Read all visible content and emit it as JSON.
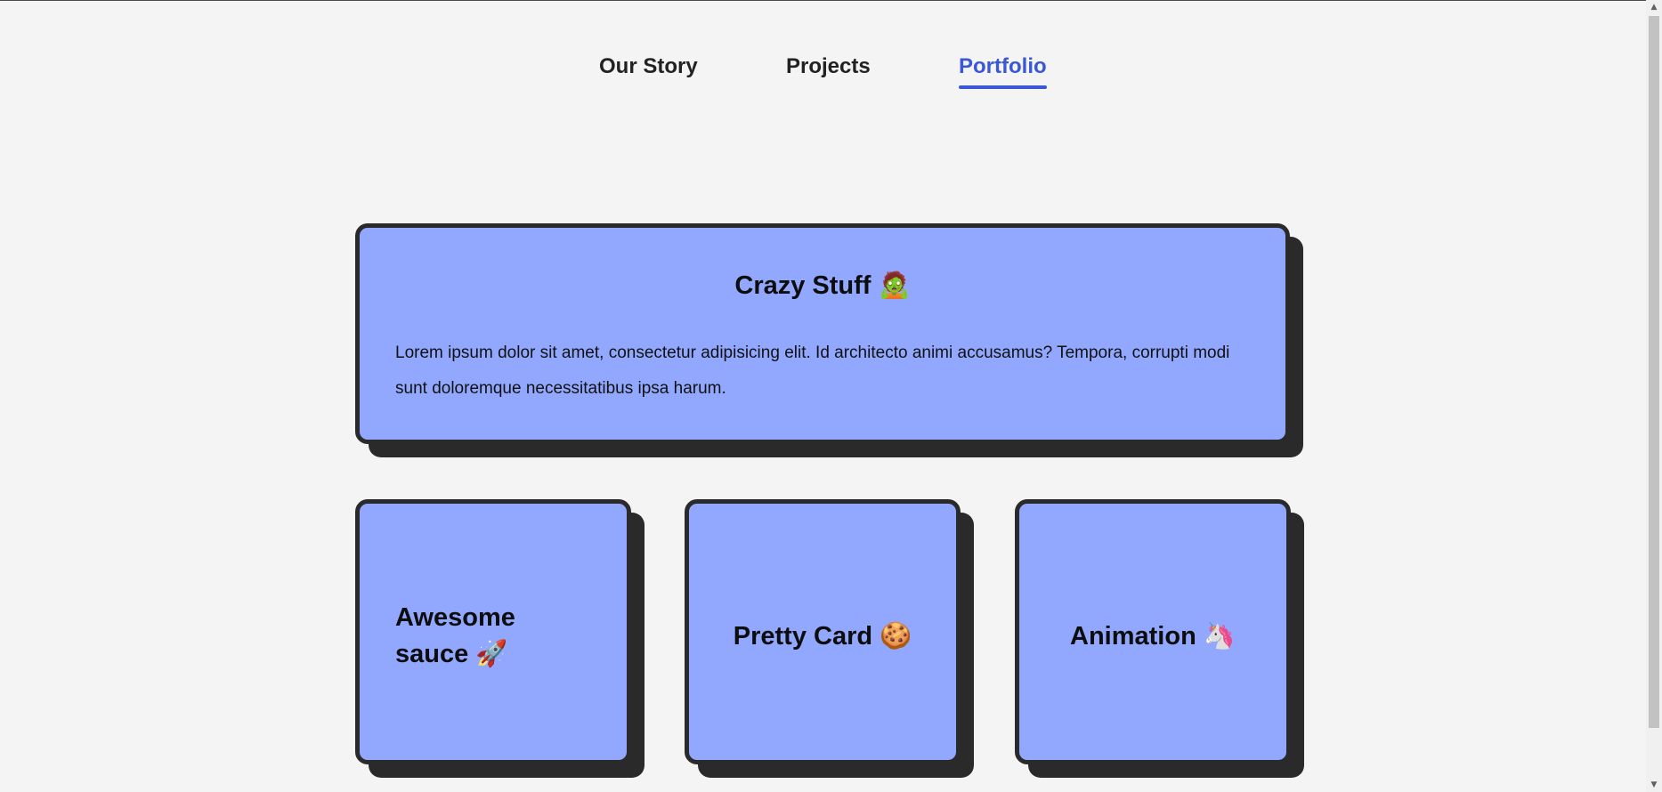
{
  "nav": {
    "items": [
      {
        "label": "Our Story",
        "active": false
      },
      {
        "label": "Projects",
        "active": false
      },
      {
        "label": "Portfolio",
        "active": true
      }
    ]
  },
  "featured_card": {
    "title": "Crazy Stuff",
    "emoji": "🧟",
    "body": "Lorem ipsum dolor sit amet, consectetur adipisicing elit. Id architecto animi accusamus? Tempora, corrupti modi sunt doloremque necessitatibus ipsa harum."
  },
  "cards": [
    {
      "title": "Awesome sauce",
      "emoji": "🚀"
    },
    {
      "title": "Pretty Card",
      "emoji": "🍪"
    },
    {
      "title": "Animation",
      "emoji": "🦄"
    }
  ],
  "colors": {
    "background": "#f4f4f4",
    "card": "#92a8ff",
    "card_border": "#2a2a2a",
    "accent": "#3a57d6",
    "text": "#222222"
  },
  "icons": {
    "scroll_up": "scroll-up-arrow-icon",
    "scroll_down": "scroll-down-arrow-icon"
  }
}
